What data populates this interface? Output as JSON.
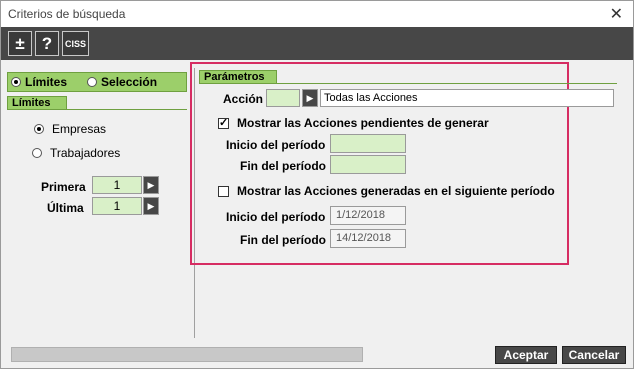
{
  "window": {
    "title": "Criterios de búsqueda",
    "close_symbol": "✕"
  },
  "toolbar": {
    "plus_minus": "±",
    "help": "?",
    "ciss": "CISS"
  },
  "mode": {
    "option1": "Límites",
    "option2": "Selección",
    "selected": "Límites"
  },
  "limites": {
    "tab": "Límites",
    "radio1": "Empresas",
    "radio2": "Trabajadores",
    "selected": "Empresas",
    "primera_label": "Primera",
    "primera_value": "1",
    "ultima_label": "Última",
    "ultima_value": "1"
  },
  "parametros": {
    "tab": "Parámetros",
    "accion_label": "Acción",
    "accion_code": "",
    "accion_text": "Todas las Acciones",
    "check1_label": "Mostrar las Acciones pendientes de generar",
    "check1_checked": true,
    "inicio1_label": "Inicio del período",
    "inicio1_value": "",
    "fin1_label": "Fin del período",
    "fin1_value": "",
    "check2_label": "Mostrar las Acciones generadas en el siguiente período",
    "check2_checked": false,
    "inicio2_label": "Inicio del período",
    "inicio2_value": "1/12/2018",
    "fin2_label": "Fin del período",
    "fin2_value": "14/12/2018"
  },
  "buttons": {
    "accept": "Aceptar",
    "cancel": "Cancelar"
  },
  "icons": {
    "spin": "▶"
  },
  "colors": {
    "accent_green": "#9ccf6a",
    "highlight_border": "#d62c62",
    "toolbar": "#474747"
  }
}
